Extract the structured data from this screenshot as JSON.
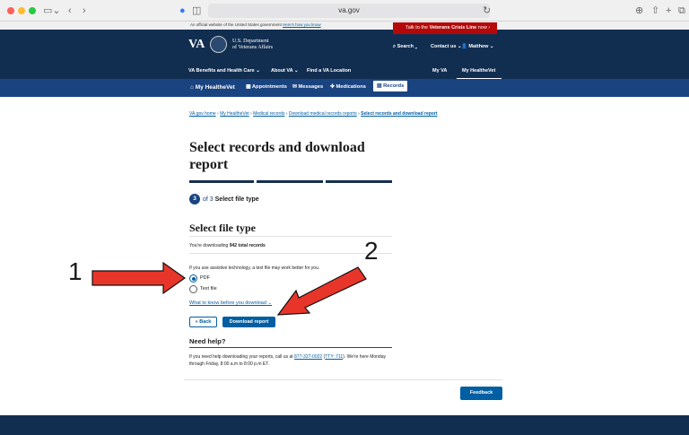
{
  "browser": {
    "url": "va.gov"
  },
  "official_banner": {
    "text": "An official website of the United States government",
    "link": "Here's how you know"
  },
  "crisis_line": {
    "prefix": "Talk to the",
    "bold": "Veterans Crisis Line",
    "suffix": "now"
  },
  "header": {
    "logo": "VA",
    "dept_line1": "U.S. Department",
    "dept_line2": "of Veterans Affairs",
    "search": "Search",
    "contact": "Contact us",
    "user": "Matthew"
  },
  "nav": {
    "benefits": "VA Benefits and Health Care",
    "about": "About VA",
    "find": "Find a VA Location",
    "myva": "My VA",
    "myhealthevet": "My HealtheVet"
  },
  "subnav": {
    "home": "My HealtheVet",
    "appointments": "Appointments",
    "messages": "Messages",
    "medications": "Medications",
    "records": "Records"
  },
  "breadcrumb": {
    "items": [
      "VA.gov home",
      "My HealtheVet",
      "Medical records",
      "Download medical records reports"
    ],
    "current": "Select records and download report",
    "separator": "›"
  },
  "page": {
    "title": "Select records and download report",
    "step_number": "3",
    "step_of": "of 3",
    "step_name": "Select file type",
    "section_title": "Select file type",
    "downloading_prefix": "You're downloading",
    "downloading_count": "942 total records",
    "assistive_text": "If you use assistive technology, a text file may work better for you.",
    "options": [
      {
        "label": "PDF",
        "selected": true
      },
      {
        "label": "Text file",
        "selected": false
      }
    ],
    "what_to_know": "What to know before you download",
    "back_label": "Back",
    "download_label": "Download report",
    "help_title": "Need help?",
    "help_text_1": "If you need help downloading your reports, call us at",
    "help_phone": "877-327-0022",
    "help_tty": "TTY: 711",
    "help_text_2": ". We're here Monday through Friday, 8:00 a.m to 8:00 p.m ET.",
    "feedback_label": "Feedback"
  },
  "annotations": {
    "label_1": "1",
    "label_2": "2",
    "arrow_color": "#e8352a"
  },
  "colors": {
    "header": "#112e51",
    "subnav": "#1a4480",
    "primary": "#005ea2",
    "crisis": "#b50909"
  }
}
